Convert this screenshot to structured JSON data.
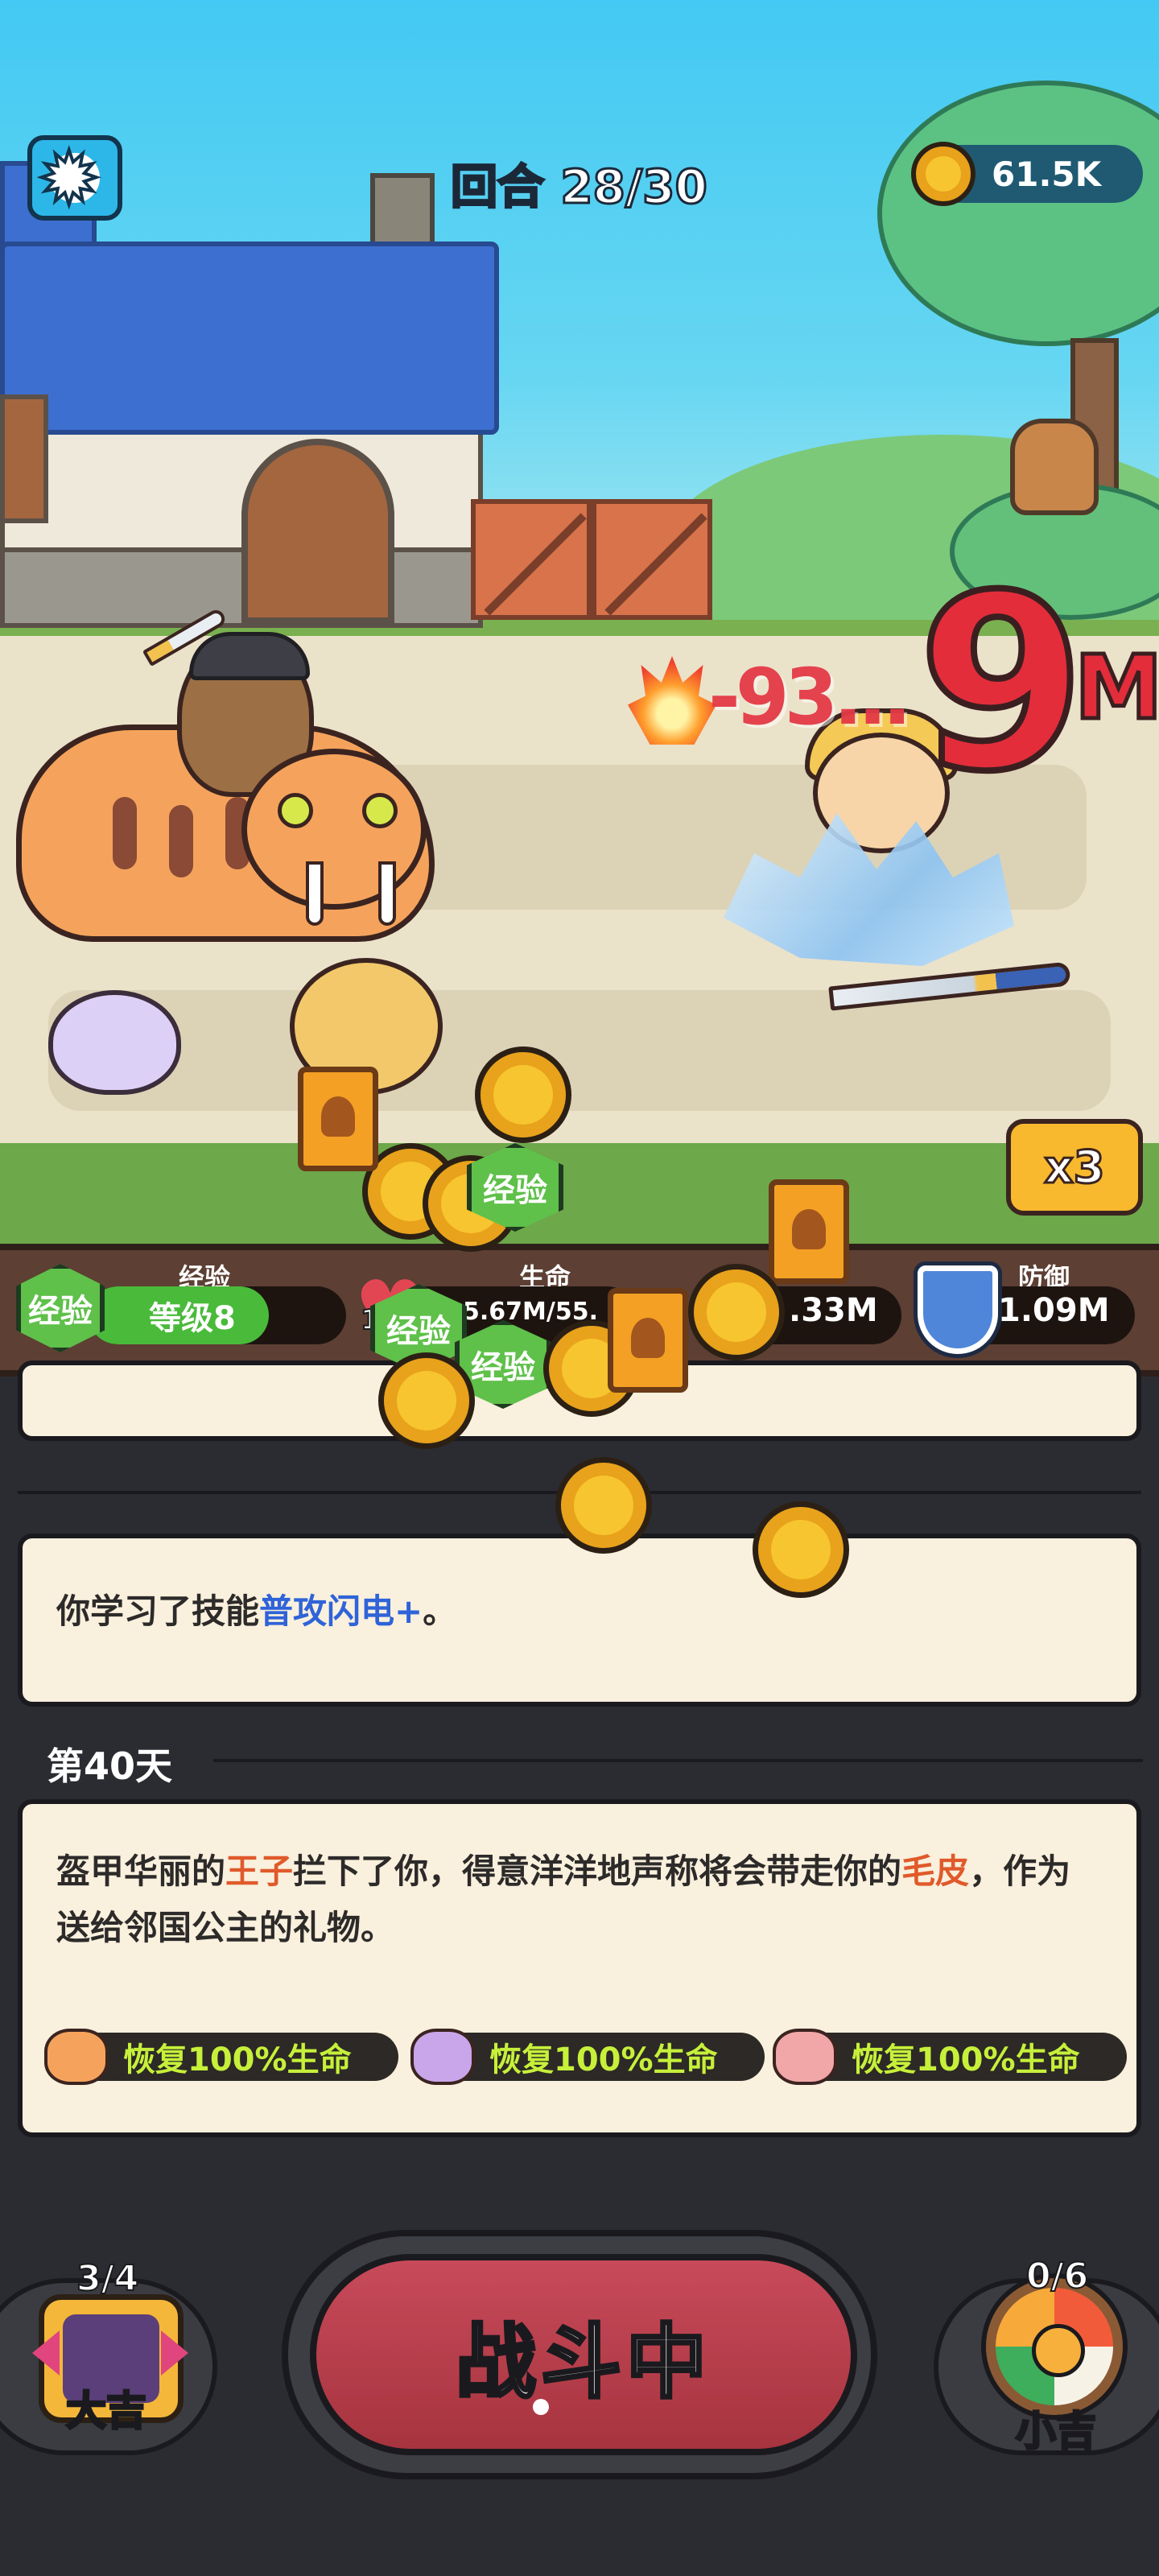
{
  "hud": {
    "round_label": "回合 28/30",
    "coins": "61.5K",
    "speed_label": "x3"
  },
  "battle": {
    "damage_small": "-93...",
    "damage_big": "9",
    "damage_unit": "M"
  },
  "stats": {
    "exp_label": "经验",
    "exp_badge": "经验",
    "exp_level": "等级8",
    "exp_progress": 0.7,
    "hp_label": "生命",
    "hp_value": "5.67M/55.",
    "hp_prefix": "1",
    "hp_progress": 0.1,
    "attack_value": ".33M",
    "defense_label": "防御",
    "defense_value": "1.09M"
  },
  "log": {
    "skill_prefix": "你学习了技能",
    "skill_name": "普攻闪电+",
    "skill_suffix": "。",
    "day_label": "第40天",
    "event_part1": "盔甲华丽的",
    "event_prince": "王子",
    "event_part2": "拦下了你，得意洋洋地声称将会带走你的",
    "event_fur": "毛皮",
    "event_part3": "，作为送给邻国公主的礼物。",
    "rewards": [
      {
        "label": "恢复100%生命",
        "icon": "tiger-icon"
      },
      {
        "label": "恢复100%生命",
        "icon": "unicorn-icon"
      },
      {
        "label": "恢复100%生命",
        "icon": "pig-icon"
      }
    ]
  },
  "bottom": {
    "fight_label": "战斗中",
    "lucky_left_count": "3/4",
    "lucky_left_label": "大吉",
    "lucky_right_count": "0/6",
    "lucky_right_label": "小吉"
  },
  "fly": {
    "badge1": "经验",
    "badge2": "经验",
    "badge3": "经验"
  },
  "colors": {
    "accent_red": "#e32d3b",
    "exp_green": "#4aba3a",
    "skill_blue": "#2f63d8",
    "reward_green": "#c6f03a"
  }
}
